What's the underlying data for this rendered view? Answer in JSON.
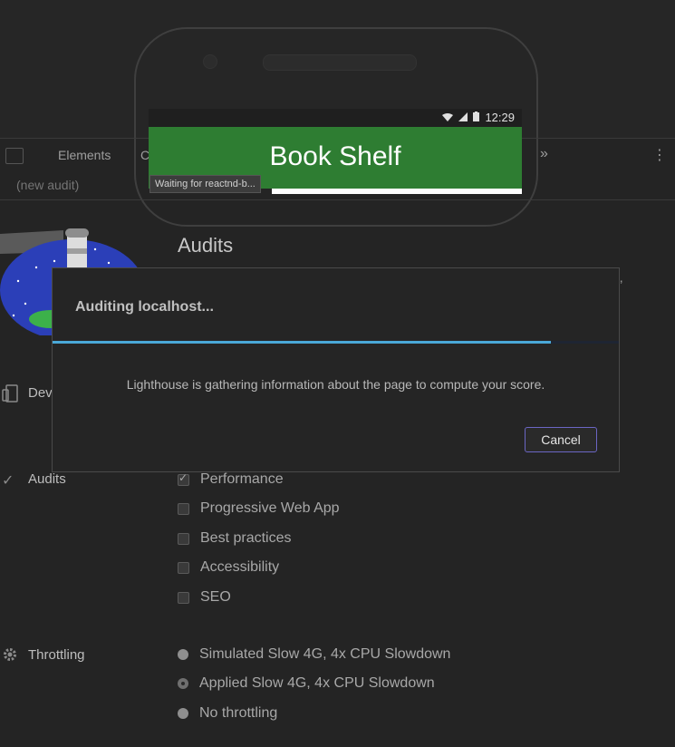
{
  "emulator": {
    "time": "12:29",
    "app_title": "Book Shelf",
    "colors": {
      "appbar": "#2e7d32"
    }
  },
  "devtools": {
    "tabs": [
      "Elements",
      "C"
    ],
    "more_glyph": "»",
    "menu_glyph": "⋮",
    "subtab_label": "(new audit)",
    "tooltip": "Waiting for reactnd-b..."
  },
  "audits_page": {
    "title": "Audits",
    "partial_text": "e,",
    "device_label": "Dev",
    "audits_label": "Audits",
    "audit_categories": [
      {
        "label": "Performance",
        "checked": true
      },
      {
        "label": "Progressive Web App",
        "checked": false
      },
      {
        "label": "Best practices",
        "checked": false
      },
      {
        "label": "Accessibility",
        "checked": false
      },
      {
        "label": "SEO",
        "checked": false
      }
    ],
    "throttling_label": "Throttling",
    "throttling_options": [
      {
        "label": "Simulated Slow 4G, 4x CPU Slowdown",
        "selected": false
      },
      {
        "label": "Applied Slow 4G, 4x CPU Slowdown",
        "selected": true
      },
      {
        "label": "No throttling",
        "selected": false
      }
    ]
  },
  "modal": {
    "title": "Auditing localhost...",
    "message": "Lighthouse is gathering information about the page to compute your score.",
    "progress": 0.88,
    "cancel_label": "Cancel",
    "colors": {
      "progress": "#4aa8d8",
      "button_border": "#6b66c4"
    }
  }
}
